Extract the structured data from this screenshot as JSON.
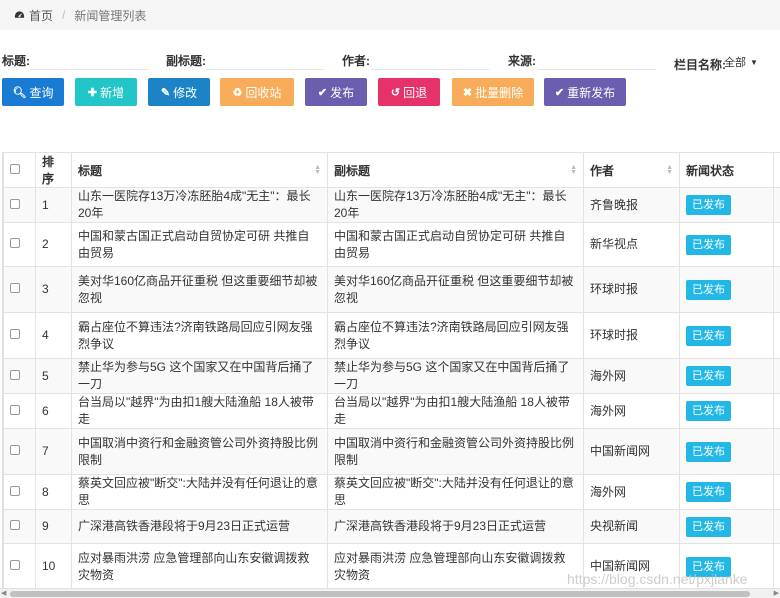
{
  "breadcrumb": {
    "home": "首页",
    "current": "新闻管理列表"
  },
  "search": {
    "title_label": "标题:",
    "subtitle_label": "副标题:",
    "author_label": "作者:",
    "source_label": "来源:",
    "column_label": "栏目名称:",
    "column_value": "全部"
  },
  "toolbar": {
    "query": "查询",
    "add": "新增",
    "edit": "修改",
    "recycle": "回收站",
    "publish": "发布",
    "rollback": "回退",
    "batch_delete": "批量删除",
    "republish": "重新发布"
  },
  "colors": {
    "query": "#1a7bd3",
    "add": "#23c6c8",
    "edit": "#1c84c6",
    "recycle": "#f8ac59",
    "publish": "#6b5eae",
    "rollback": "#e5336a",
    "batch_delete": "#f8ac59",
    "republish": "#6b5eae",
    "badge": "#23b7e5"
  },
  "table": {
    "headers": {
      "order": "排序",
      "title": "标题",
      "subtitle": "副标题",
      "author": "作者",
      "status": "新闻状态"
    },
    "rows": [
      {
        "order": "1",
        "title": "山东一医院存13万冷冻胚胎4成\"无主\"：最长20年",
        "subtitle": "山东一医院存13万冷冻胚胎4成\"无主\"：最长20年",
        "author": "齐鲁晚报",
        "status": "已发布"
      },
      {
        "order": "2",
        "title": "中国和蒙古国正式启动自贸协定可研 共推自由贸易",
        "subtitle": "中国和蒙古国正式启动自贸协定可研 共推自由贸易",
        "author": "新华视点",
        "status": "已发布"
      },
      {
        "order": "3",
        "title": "美对华160亿商品开征重税 但这重要细节却被忽视",
        "subtitle": "美对华160亿商品开征重税 但这重要细节却被忽视",
        "author": "环球时报",
        "status": "已发布"
      },
      {
        "order": "4",
        "title": "霸占座位不算违法?济南铁路局回应引网友强烈争议",
        "subtitle": "霸占座位不算违法?济南铁路局回应引网友强烈争议",
        "author": "环球时报",
        "status": "已发布"
      },
      {
        "order": "5",
        "title": "禁止华为参与5G 这个国家又在中国背后捅了一刀",
        "subtitle": "禁止华为参与5G 这个国家又在中国背后捅了一刀",
        "author": "海外网",
        "status": "已发布"
      },
      {
        "order": "6",
        "title": "台当局以\"越界\"为由扣1艘大陆渔船 18人被带走",
        "subtitle": "台当局以\"越界\"为由扣1艘大陆渔船 18人被带走",
        "author": "海外网",
        "status": "已发布"
      },
      {
        "order": "7",
        "title": "中国取消中资行和金融资管公司外资持股比例限制",
        "subtitle": "中国取消中资行和金融资管公司外资持股比例限制",
        "author": "中国新闻网",
        "status": "已发布"
      },
      {
        "order": "8",
        "title": "蔡英文回应被\"断交\":大陆并没有任何退让的意思",
        "subtitle": "蔡英文回应被\"断交\":大陆并没有任何退让的意思",
        "author": "海外网",
        "status": "已发布"
      },
      {
        "order": "9",
        "title": "广深港高铁香港段将于9月23日正式运营",
        "subtitle": "广深港高铁香港段将于9月23日正式运营",
        "author": "央视新闻",
        "status": "已发布"
      },
      {
        "order": "10",
        "title": "应对暴雨洪涝 应急管理部向山东安徽调拨救灾物资",
        "subtitle": "应对暴雨洪涝 应急管理部向山东安徽调拨救灾物资",
        "author": "中国新闻网",
        "status": "已发布"
      }
    ]
  },
  "watermark": "https://blog.csdn.net/pxjlanke"
}
